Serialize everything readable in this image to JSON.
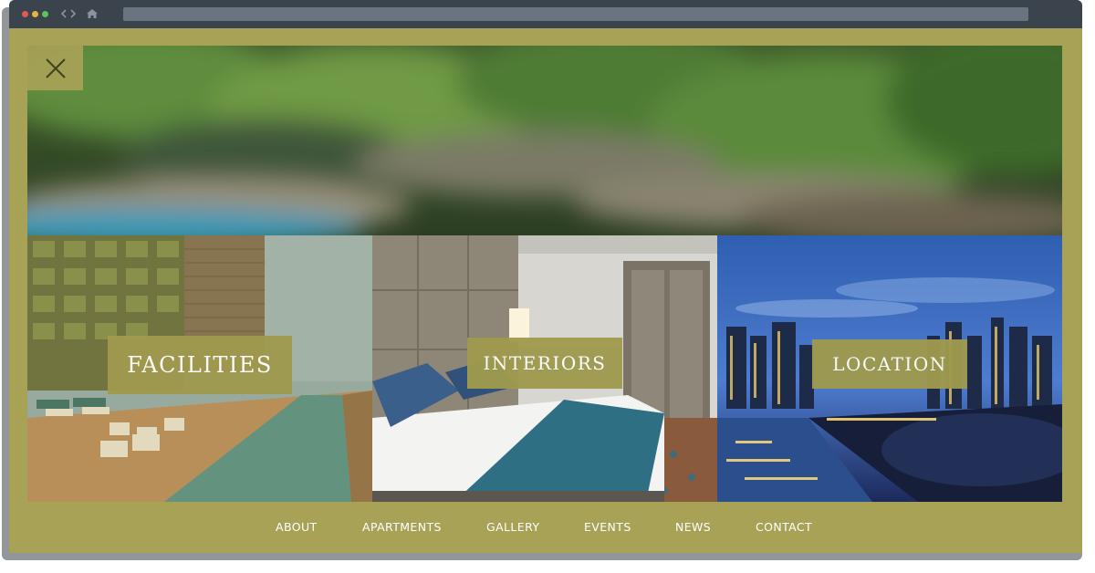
{
  "colors": {
    "olive_accent": "#a8a257",
    "browser_chrome": "#3b434d",
    "dot_red": "#e45a4e",
    "dot_yellow": "#e6b43c",
    "dot_green": "#5cc25a"
  },
  "browser": {
    "icons": [
      "back-icon",
      "forward-icon",
      "home-icon"
    ]
  },
  "overlay": {
    "close_icon": "close-icon"
  },
  "tiles": [
    {
      "label": "FACILITIES"
    },
    {
      "label": "INTERIORS"
    },
    {
      "label": "LOCATION"
    }
  ],
  "nav": {
    "items": [
      "ABOUT",
      "APARTMENTS",
      "GALLERY",
      "EVENTS",
      "NEWS",
      "CONTACT"
    ]
  }
}
